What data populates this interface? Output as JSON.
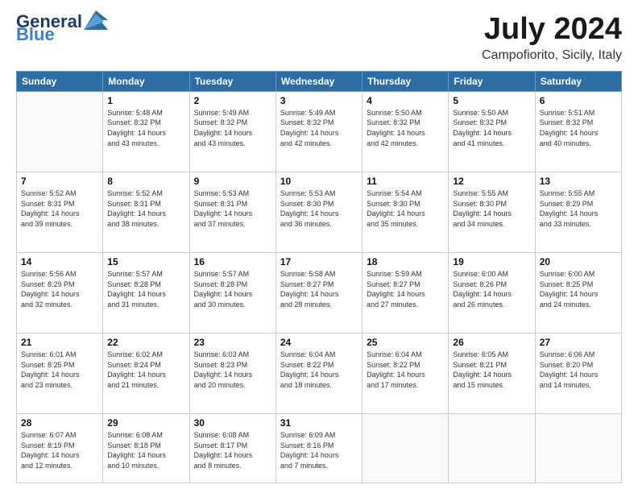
{
  "header": {
    "logo_line1": "General",
    "logo_line2": "Blue",
    "title": "July 2024",
    "subtitle": "Campofiorito, Sicily, Italy"
  },
  "weekdays": [
    "Sunday",
    "Monday",
    "Tuesday",
    "Wednesday",
    "Thursday",
    "Friday",
    "Saturday"
  ],
  "weeks": [
    [
      {
        "day": "",
        "info": ""
      },
      {
        "day": "1",
        "info": "Sunrise: 5:48 AM\nSunset: 8:32 PM\nDaylight: 14 hours\nand 43 minutes."
      },
      {
        "day": "2",
        "info": "Sunrise: 5:49 AM\nSunset: 8:32 PM\nDaylight: 14 hours\nand 43 minutes."
      },
      {
        "day": "3",
        "info": "Sunrise: 5:49 AM\nSunset: 8:32 PM\nDaylight: 14 hours\nand 42 minutes."
      },
      {
        "day": "4",
        "info": "Sunrise: 5:50 AM\nSunset: 8:32 PM\nDaylight: 14 hours\nand 42 minutes."
      },
      {
        "day": "5",
        "info": "Sunrise: 5:50 AM\nSunset: 8:32 PM\nDaylight: 14 hours\nand 41 minutes."
      },
      {
        "day": "6",
        "info": "Sunrise: 5:51 AM\nSunset: 8:32 PM\nDaylight: 14 hours\nand 40 minutes."
      }
    ],
    [
      {
        "day": "7",
        "info": "Sunrise: 5:52 AM\nSunset: 8:31 PM\nDaylight: 14 hours\nand 39 minutes."
      },
      {
        "day": "8",
        "info": "Sunrise: 5:52 AM\nSunset: 8:31 PM\nDaylight: 14 hours\nand 38 minutes."
      },
      {
        "day": "9",
        "info": "Sunrise: 5:53 AM\nSunset: 8:31 PM\nDaylight: 14 hours\nand 37 minutes."
      },
      {
        "day": "10",
        "info": "Sunrise: 5:53 AM\nSunset: 8:30 PM\nDaylight: 14 hours\nand 36 minutes."
      },
      {
        "day": "11",
        "info": "Sunrise: 5:54 AM\nSunset: 8:30 PM\nDaylight: 14 hours\nand 35 minutes."
      },
      {
        "day": "12",
        "info": "Sunrise: 5:55 AM\nSunset: 8:30 PM\nDaylight: 14 hours\nand 34 minutes."
      },
      {
        "day": "13",
        "info": "Sunrise: 5:55 AM\nSunset: 8:29 PM\nDaylight: 14 hours\nand 33 minutes."
      }
    ],
    [
      {
        "day": "14",
        "info": "Sunrise: 5:56 AM\nSunset: 8:29 PM\nDaylight: 14 hours\nand 32 minutes."
      },
      {
        "day": "15",
        "info": "Sunrise: 5:57 AM\nSunset: 8:28 PM\nDaylight: 14 hours\nand 31 minutes."
      },
      {
        "day": "16",
        "info": "Sunrise: 5:57 AM\nSunset: 8:28 PM\nDaylight: 14 hours\nand 30 minutes."
      },
      {
        "day": "17",
        "info": "Sunrise: 5:58 AM\nSunset: 8:27 PM\nDaylight: 14 hours\nand 28 minutes."
      },
      {
        "day": "18",
        "info": "Sunrise: 5:59 AM\nSunset: 8:27 PM\nDaylight: 14 hours\nand 27 minutes."
      },
      {
        "day": "19",
        "info": "Sunrise: 6:00 AM\nSunset: 8:26 PM\nDaylight: 14 hours\nand 26 minutes."
      },
      {
        "day": "20",
        "info": "Sunrise: 6:00 AM\nSunset: 8:25 PM\nDaylight: 14 hours\nand 24 minutes."
      }
    ],
    [
      {
        "day": "21",
        "info": "Sunrise: 6:01 AM\nSunset: 8:25 PM\nDaylight: 14 hours\nand 23 minutes."
      },
      {
        "day": "22",
        "info": "Sunrise: 6:02 AM\nSunset: 8:24 PM\nDaylight: 14 hours\nand 21 minutes."
      },
      {
        "day": "23",
        "info": "Sunrise: 6:03 AM\nSunset: 8:23 PM\nDaylight: 14 hours\nand 20 minutes."
      },
      {
        "day": "24",
        "info": "Sunrise: 6:04 AM\nSunset: 8:22 PM\nDaylight: 14 hours\nand 18 minutes."
      },
      {
        "day": "25",
        "info": "Sunrise: 6:04 AM\nSunset: 8:22 PM\nDaylight: 14 hours\nand 17 minutes."
      },
      {
        "day": "26",
        "info": "Sunrise: 6:05 AM\nSunset: 8:21 PM\nDaylight: 14 hours\nand 15 minutes."
      },
      {
        "day": "27",
        "info": "Sunrise: 6:06 AM\nSunset: 8:20 PM\nDaylight: 14 hours\nand 14 minutes."
      }
    ],
    [
      {
        "day": "28",
        "info": "Sunrise: 6:07 AM\nSunset: 8:19 PM\nDaylight: 14 hours\nand 12 minutes."
      },
      {
        "day": "29",
        "info": "Sunrise: 6:08 AM\nSunset: 8:18 PM\nDaylight: 14 hours\nand 10 minutes."
      },
      {
        "day": "30",
        "info": "Sunrise: 6:08 AM\nSunset: 8:17 PM\nDaylight: 14 hours\nand 8 minutes."
      },
      {
        "day": "31",
        "info": "Sunrise: 6:09 AM\nSunset: 8:16 PM\nDaylight: 14 hours\nand 7 minutes."
      },
      {
        "day": "",
        "info": ""
      },
      {
        "day": "",
        "info": ""
      },
      {
        "day": "",
        "info": ""
      }
    ]
  ]
}
